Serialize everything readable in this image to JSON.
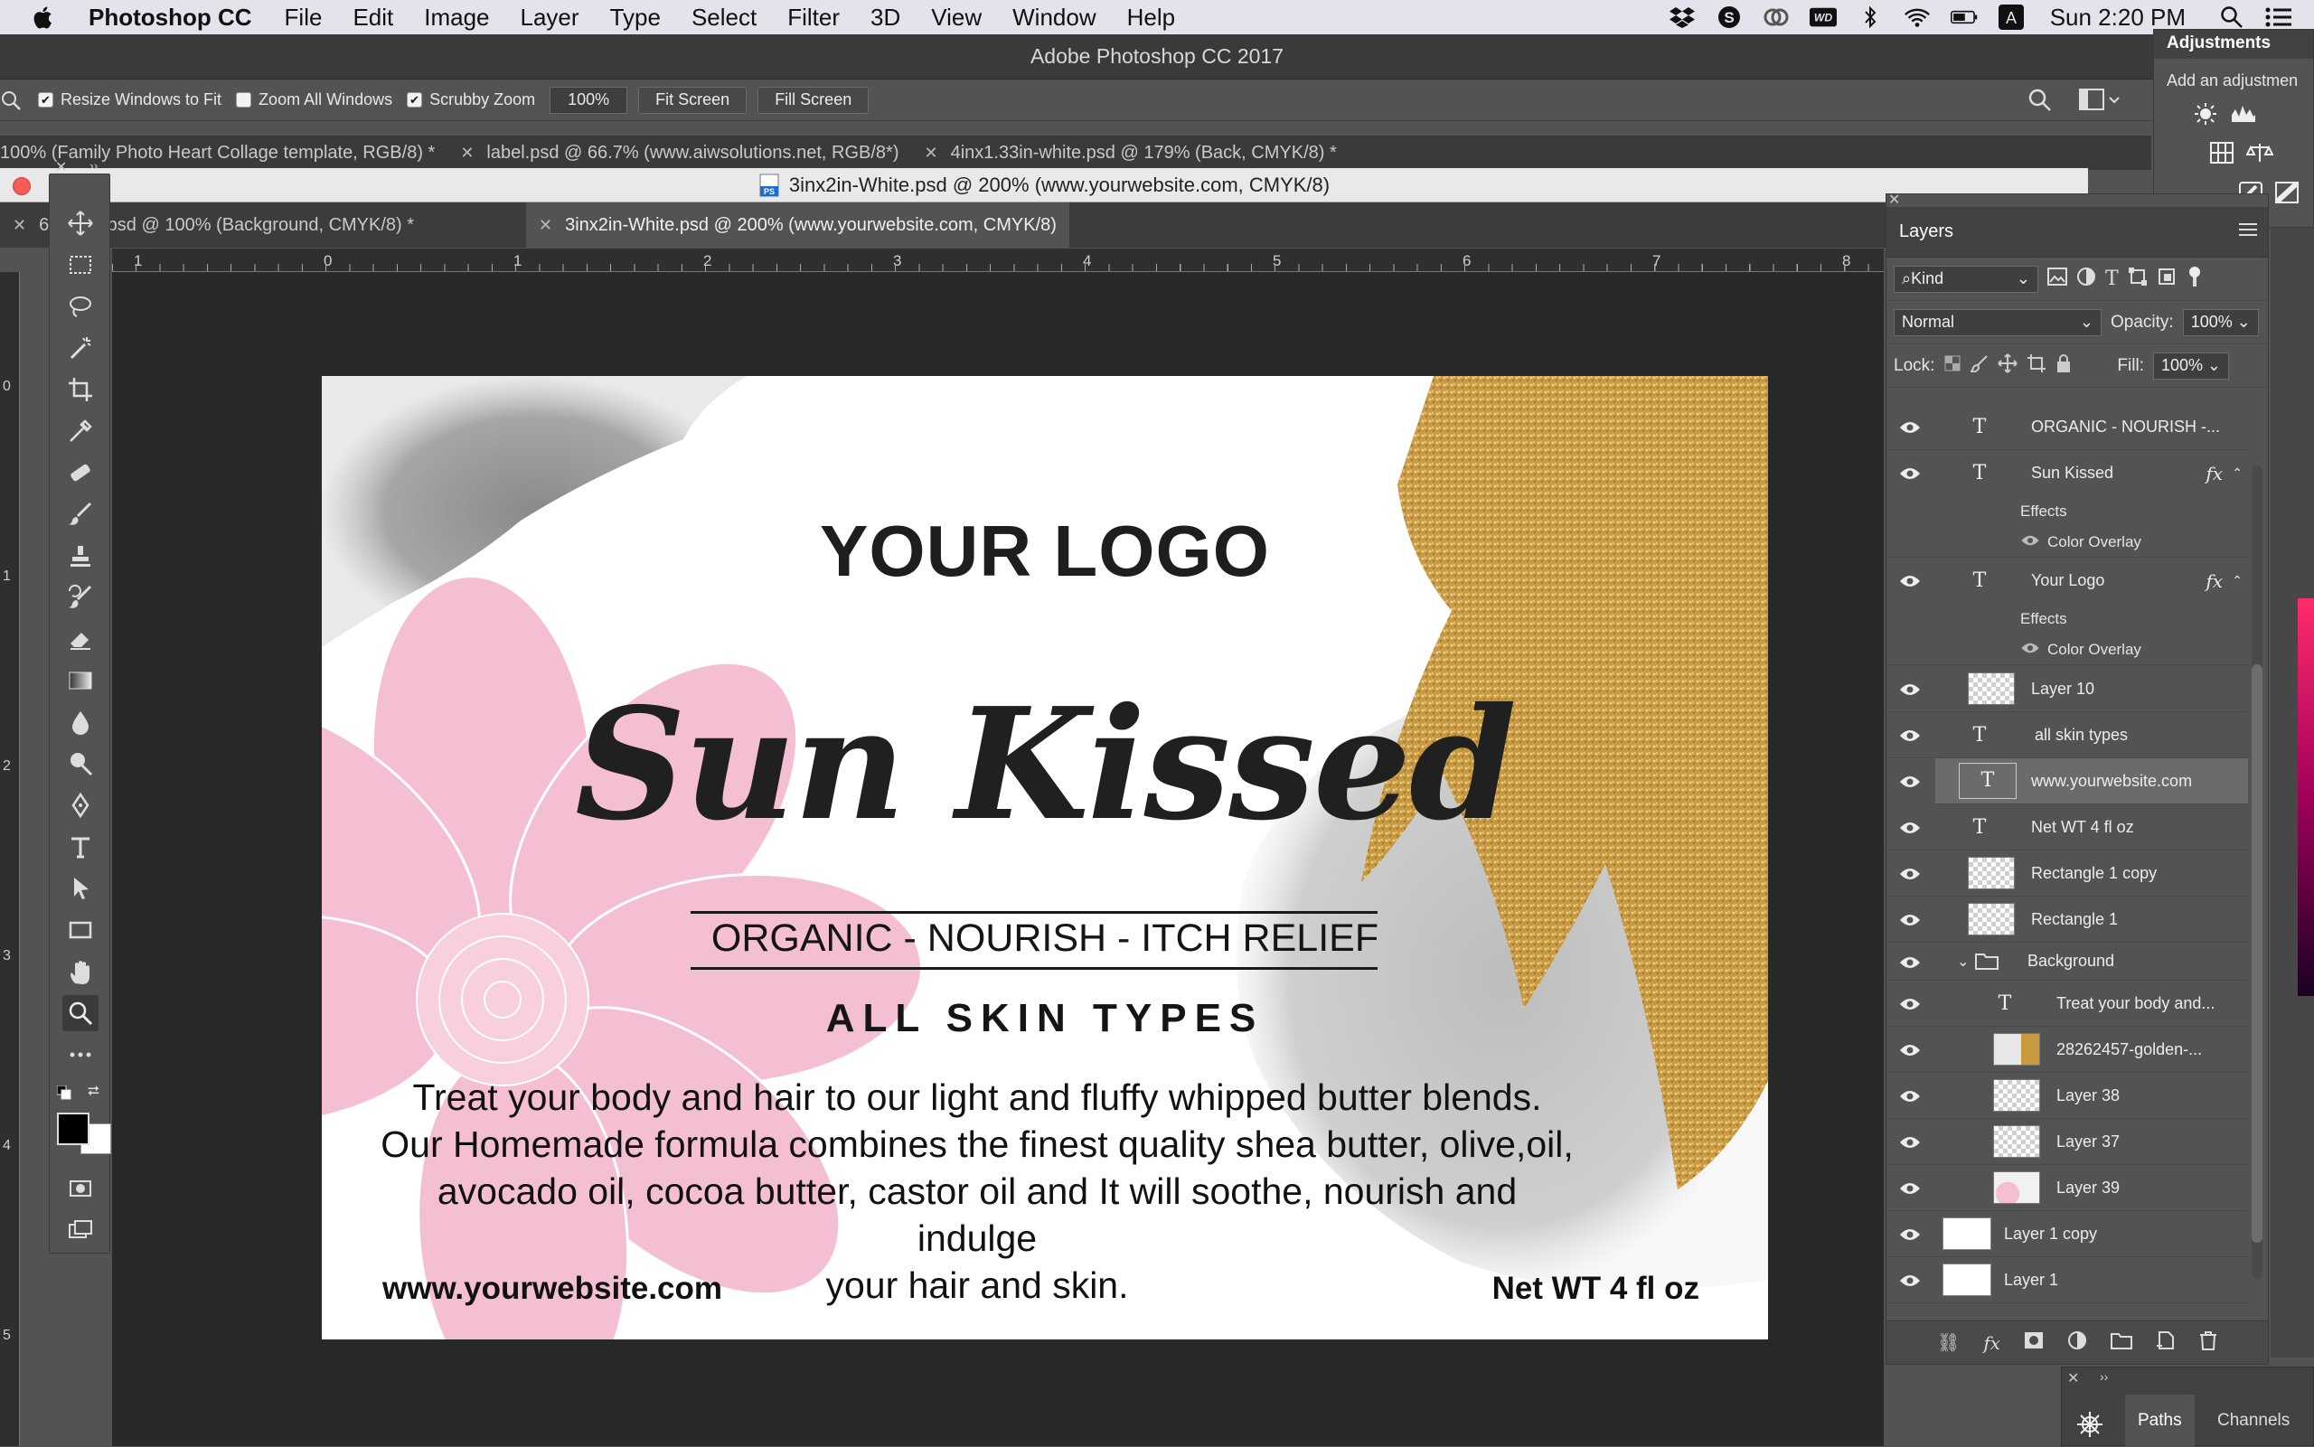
{
  "menubar": {
    "app": "Photoshop CC",
    "items": [
      "File",
      "Edit",
      "Image",
      "Layer",
      "Type",
      "Select",
      "Filter",
      "3D",
      "View",
      "Window",
      "Help"
    ],
    "clock": "Sun 2:20 PM"
  },
  "title": "Adobe Photoshop CC 2017",
  "options": {
    "resize_windows": "Resize Windows to Fit",
    "zoom_all": "Zoom All Windows",
    "scrubby": "Scrubby Zoom",
    "zoom_value": "100%",
    "fit_screen": "Fit Screen",
    "fill_screen": "Fill Screen"
  },
  "tabs_back": [
    "100% (Family Photo Heart Collage template, RGB/8) *",
    "label.psd @ 66.7% (www.aiwsolutions.net, RGB/8*)",
    "4inx1.33in-white.psd @ 179% (Back, CMYK/8) *"
  ],
  "doc_window_title": "3inx2in-White.psd @ 200% (www.yourwebsite.com, CMYK/8)",
  "tabs_front": [
    "6 -white.psd @ 100% (Background, CMYK/8) *",
    "3inx2in-White.psd @ 200% (www.yourwebsite.com, CMYK/8)"
  ],
  "ruler_h": [
    "1",
    "0",
    "1",
    "2",
    "3",
    "4",
    "5",
    "6",
    "7",
    "8"
  ],
  "ruler_v": [
    "0",
    "1",
    "2",
    "3",
    "4",
    "5"
  ],
  "label": {
    "logo": "YOUR LOGO",
    "script": "Sun Kissed",
    "tagline": "ORGANIC - NOURISH - ITCH RELIEF",
    "skin": "ALL SKIN TYPES",
    "desc_lines": [
      "Treat your body and hair to our light and fluffy whipped butter blends.",
      "Our Homemade formula combines the finest quality shea butter, olive,oil,",
      "avocado oil, cocoa butter, castor oil and It will soothe, nourish and indulge",
      "your hair and skin."
    ],
    "website": "www.yourwebsite.com",
    "net": "Net WT 4 fl oz"
  },
  "layers_panel": {
    "title": "Layers",
    "kind": "Kind",
    "blend": "Normal",
    "opacity_label": "Opacity:",
    "opacity": "100%",
    "lock_label": "Lock:",
    "fill_label": "Fill:",
    "fill": "100%",
    "effects": "Effects",
    "color_overlay": "Color Overlay",
    "layers": [
      "ORGANIC - NOURISH -...",
      "Sun Kissed",
      "Your Logo",
      "Layer 10",
      "all skin types",
      "www.yourwebsite.com",
      "Net WT 4 fl oz",
      "Rectangle 1 copy",
      "Rectangle 1",
      "Background",
      "Treat your body and...",
      "28262457-golden-...",
      "Layer 38",
      "Layer 37",
      "Layer 39",
      "Layer 1 copy",
      "Layer 1"
    ]
  },
  "adjustments": {
    "title": "Adjustments",
    "hint": "Add an adjustmen"
  },
  "bottom_panel": {
    "paths": "Paths",
    "channels": "Channels"
  },
  "colors": {
    "pink": "#f4bfd3",
    "gold": "#c99a3e",
    "gray_wash": "#9b9b9b"
  }
}
